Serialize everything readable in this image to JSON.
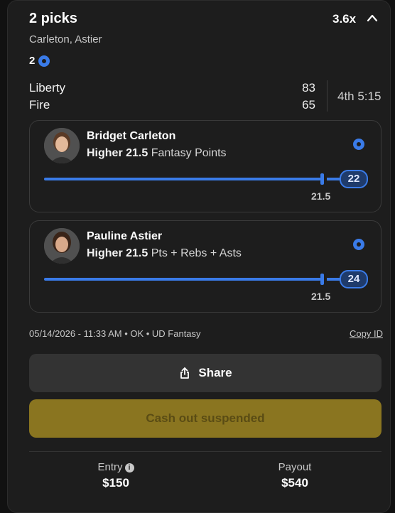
{
  "header": {
    "title": "2 picks",
    "multiplier": "3.6x",
    "players": "Carleton, Astier",
    "pick_count": "2"
  },
  "game": {
    "team1": "Liberty",
    "team2": "Fire",
    "score1": "83",
    "score2": "65",
    "clock": "4th 5:15"
  },
  "picks": [
    {
      "name": "Bridget Carleton",
      "direction": "Higher 21.5",
      "stat": "Fantasy Points",
      "current": "22",
      "line": "21.5"
    },
    {
      "name": "Pauline Astier",
      "direction": "Higher 21.5",
      "stat": "Pts + Rebs + Asts",
      "current": "24",
      "line": "21.5"
    }
  ],
  "meta": {
    "info": "05/14/2026 - 11:33 AM • OK • UD Fantasy",
    "copy_id": "Copy ID"
  },
  "actions": {
    "share": "Share",
    "cash_out": "Cash out suspended"
  },
  "footer": {
    "entry_label": "Entry",
    "entry_value": "$150",
    "payout_label": "Payout",
    "payout_value": "$540"
  },
  "colors": {
    "accent": "#3a7be8",
    "cash_button": "#8a7520",
    "background": "#1d1d1d"
  }
}
